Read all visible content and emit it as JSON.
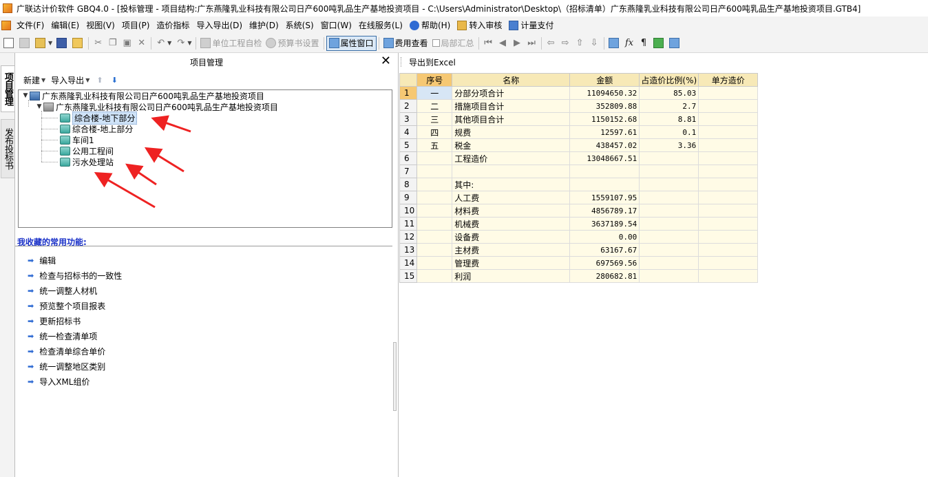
{
  "window": {
    "title": "广联达计价软件 GBQ4.0 - [投标管理 - 项目结构:广东燕隆乳业科技有限公司日产600吨乳品生产基地投资项目 - C:\\Users\\Administrator\\Desktop\\（招标清单）广东燕隆乳业科技有限公司日产600吨乳品生产基地投资项目.GTB4]"
  },
  "menu": {
    "items": [
      "文件(F)",
      "编辑(E)",
      "视图(V)",
      "项目(P)",
      "造价指标",
      "导入导出(D)",
      "维护(D)",
      "系统(S)",
      "窗口(W)",
      "在线服务(L)",
      "帮助(H)",
      "转入审核",
      "计量支付"
    ]
  },
  "toolbar": {
    "unit_check": "单位工程自检",
    "budget_settings": "预算书设置",
    "property_window": "属性窗口",
    "fee_view": "费用查看",
    "partial_summary": "局部汇总"
  },
  "vtabs": {
    "project_mgmt": "项目管理",
    "publish_bid": "发布投标书"
  },
  "project_panel": {
    "title": "项目管理",
    "close": "✕",
    "new_label": "新建",
    "import_export_label": "导入导出",
    "tree": {
      "root": "广东燕隆乳业科技有限公司日产600吨乳品生产基地投资项目",
      "building": "广东燕隆乳业科技有限公司日产600吨乳品生产基地投资项目",
      "units": [
        "综合楼-地下部分",
        "综合楼-地上部分",
        "车间1",
        "公用工程间",
        "污水处理站"
      ]
    },
    "favorites_title": "我收藏的常用功能:",
    "favorites": [
      "编辑",
      "检查与招标书的一致性",
      "统一调整人材机",
      "预览整个项目报表",
      "更新招标书",
      "统一检查清单项",
      "检查清单综合单价",
      "统一调整地区类别",
      "导入XML组价"
    ]
  },
  "grid_panel": {
    "export_label": "导出到Excel",
    "headers": [
      "序号",
      "名称",
      "金额",
      "占造价比例(%)",
      "单方造价"
    ],
    "rows": [
      {
        "no": "1",
        "seq": "一",
        "name": "分部分项合计",
        "amount": "11094650.32",
        "ratio": "85.03",
        "unit": ""
      },
      {
        "no": "2",
        "seq": "二",
        "name": "措施项目合计",
        "amount": "352809.88",
        "ratio": "2.7",
        "unit": ""
      },
      {
        "no": "3",
        "seq": "三",
        "name": "其他项目合计",
        "amount": "1150152.68",
        "ratio": "8.81",
        "unit": ""
      },
      {
        "no": "4",
        "seq": "四",
        "name": "规费",
        "amount": "12597.61",
        "ratio": "0.1",
        "unit": ""
      },
      {
        "no": "5",
        "seq": "五",
        "name": "税金",
        "amount": "438457.02",
        "ratio": "3.36",
        "unit": ""
      },
      {
        "no": "6",
        "seq": "",
        "name": "工程造价",
        "amount": "13048667.51",
        "ratio": "",
        "unit": ""
      },
      {
        "no": "7",
        "seq": "",
        "name": "",
        "amount": "",
        "ratio": "",
        "unit": ""
      },
      {
        "no": "8",
        "seq": "",
        "name": "其中:",
        "amount": "",
        "ratio": "",
        "unit": ""
      },
      {
        "no": "9",
        "seq": "",
        "name": "人工费",
        "amount": "1559107.95",
        "ratio": "",
        "unit": ""
      },
      {
        "no": "10",
        "seq": "",
        "name": "材料费",
        "amount": "4856789.17",
        "ratio": "",
        "unit": ""
      },
      {
        "no": "11",
        "seq": "",
        "name": "机械费",
        "amount": "3637189.54",
        "ratio": "",
        "unit": ""
      },
      {
        "no": "12",
        "seq": "",
        "name": "设备费",
        "amount": "0.00",
        "ratio": "",
        "unit": ""
      },
      {
        "no": "13",
        "seq": "",
        "name": "主材费",
        "amount": "63167.67",
        "ratio": "",
        "unit": ""
      },
      {
        "no": "14",
        "seq": "",
        "name": "管理费",
        "amount": "697569.56",
        "ratio": "",
        "unit": ""
      },
      {
        "no": "15",
        "seq": "",
        "name": "利润",
        "amount": "280682.81",
        "ratio": "",
        "unit": ""
      }
    ]
  },
  "colors": {
    "header_bg": "#f7e9b7",
    "cell_bg": "#fffbe6",
    "favorites_title": "#1a31c8",
    "annotation_arrow": "#ee2222"
  }
}
